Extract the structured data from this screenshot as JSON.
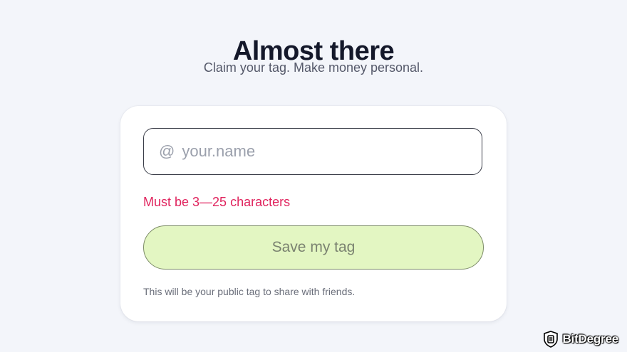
{
  "header": {
    "title": "Almost there",
    "subtitle": "Claim your tag. Make money personal."
  },
  "form": {
    "tag_prefix": "@",
    "tag_placeholder": "your.name",
    "tag_value": "",
    "error_message": "Must be 3—25 characters",
    "save_label": "Save my tag",
    "helper_text": "This will be your public tag to share with friends."
  },
  "colors": {
    "error": "#e0245e",
    "button_bg": "#e3f6c2",
    "page_bg": "#f3f5fa"
  },
  "watermark": {
    "brand": "BitDegree",
    "icon": "bitdegree-shield-logo"
  }
}
